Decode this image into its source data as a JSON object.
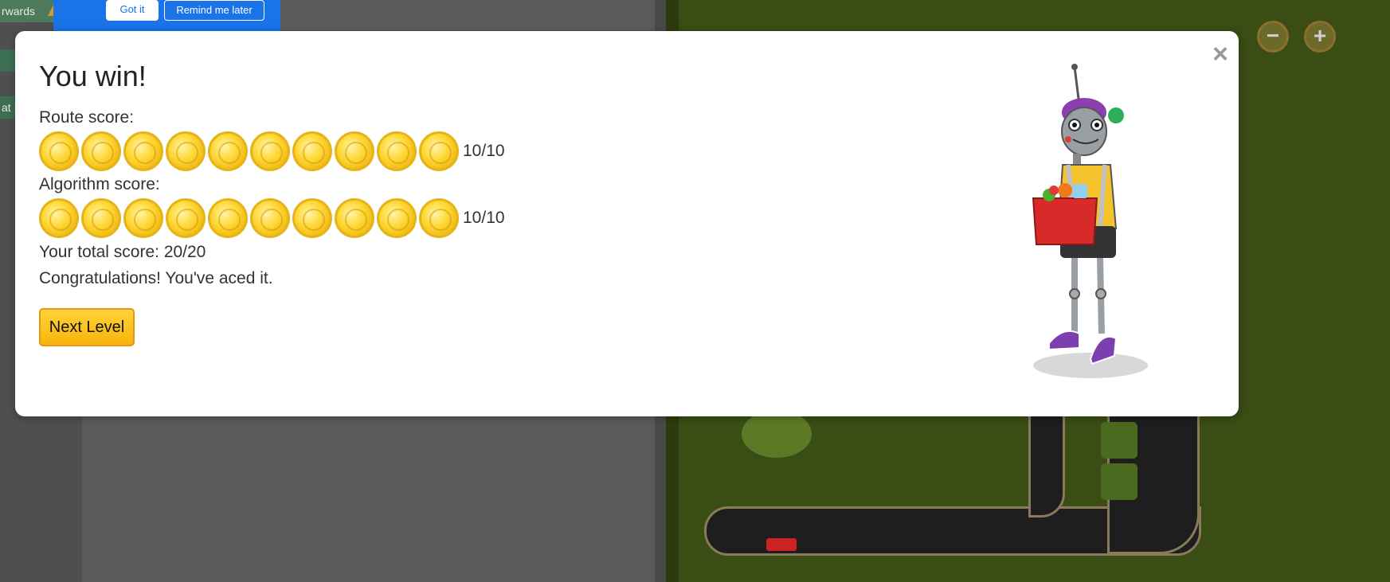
{
  "toolbox": {
    "block1_label": "rwards",
    "block2_label": "",
    "block3_label": "at"
  },
  "cookie_bar": {
    "got_it_label": "Got it",
    "remind_label": "Remind me later"
  },
  "map": {
    "zoom_out_label": "−",
    "zoom_in_label": "+"
  },
  "modal": {
    "title": "You win!",
    "close_label": "×",
    "route_label": "Route score:",
    "route_score": "10/10",
    "route_coins": 10,
    "algorithm_label": "Algorithm score:",
    "algorithm_score": "10/10",
    "algorithm_coins": 10,
    "total_line": "Your total score: 20/20",
    "congrats_line": "Congratulations! You've aced it.",
    "next_button_label": "Next Level"
  },
  "colors": {
    "accent": "#1a73e8",
    "coin_gold": "#f1b80f",
    "next_button": "#f7b40b",
    "grass": "#3a4d14"
  },
  "icons": [
    "close-icon",
    "coin-icon",
    "zoom-out-icon",
    "zoom-in-icon",
    "robot-illustration"
  ]
}
